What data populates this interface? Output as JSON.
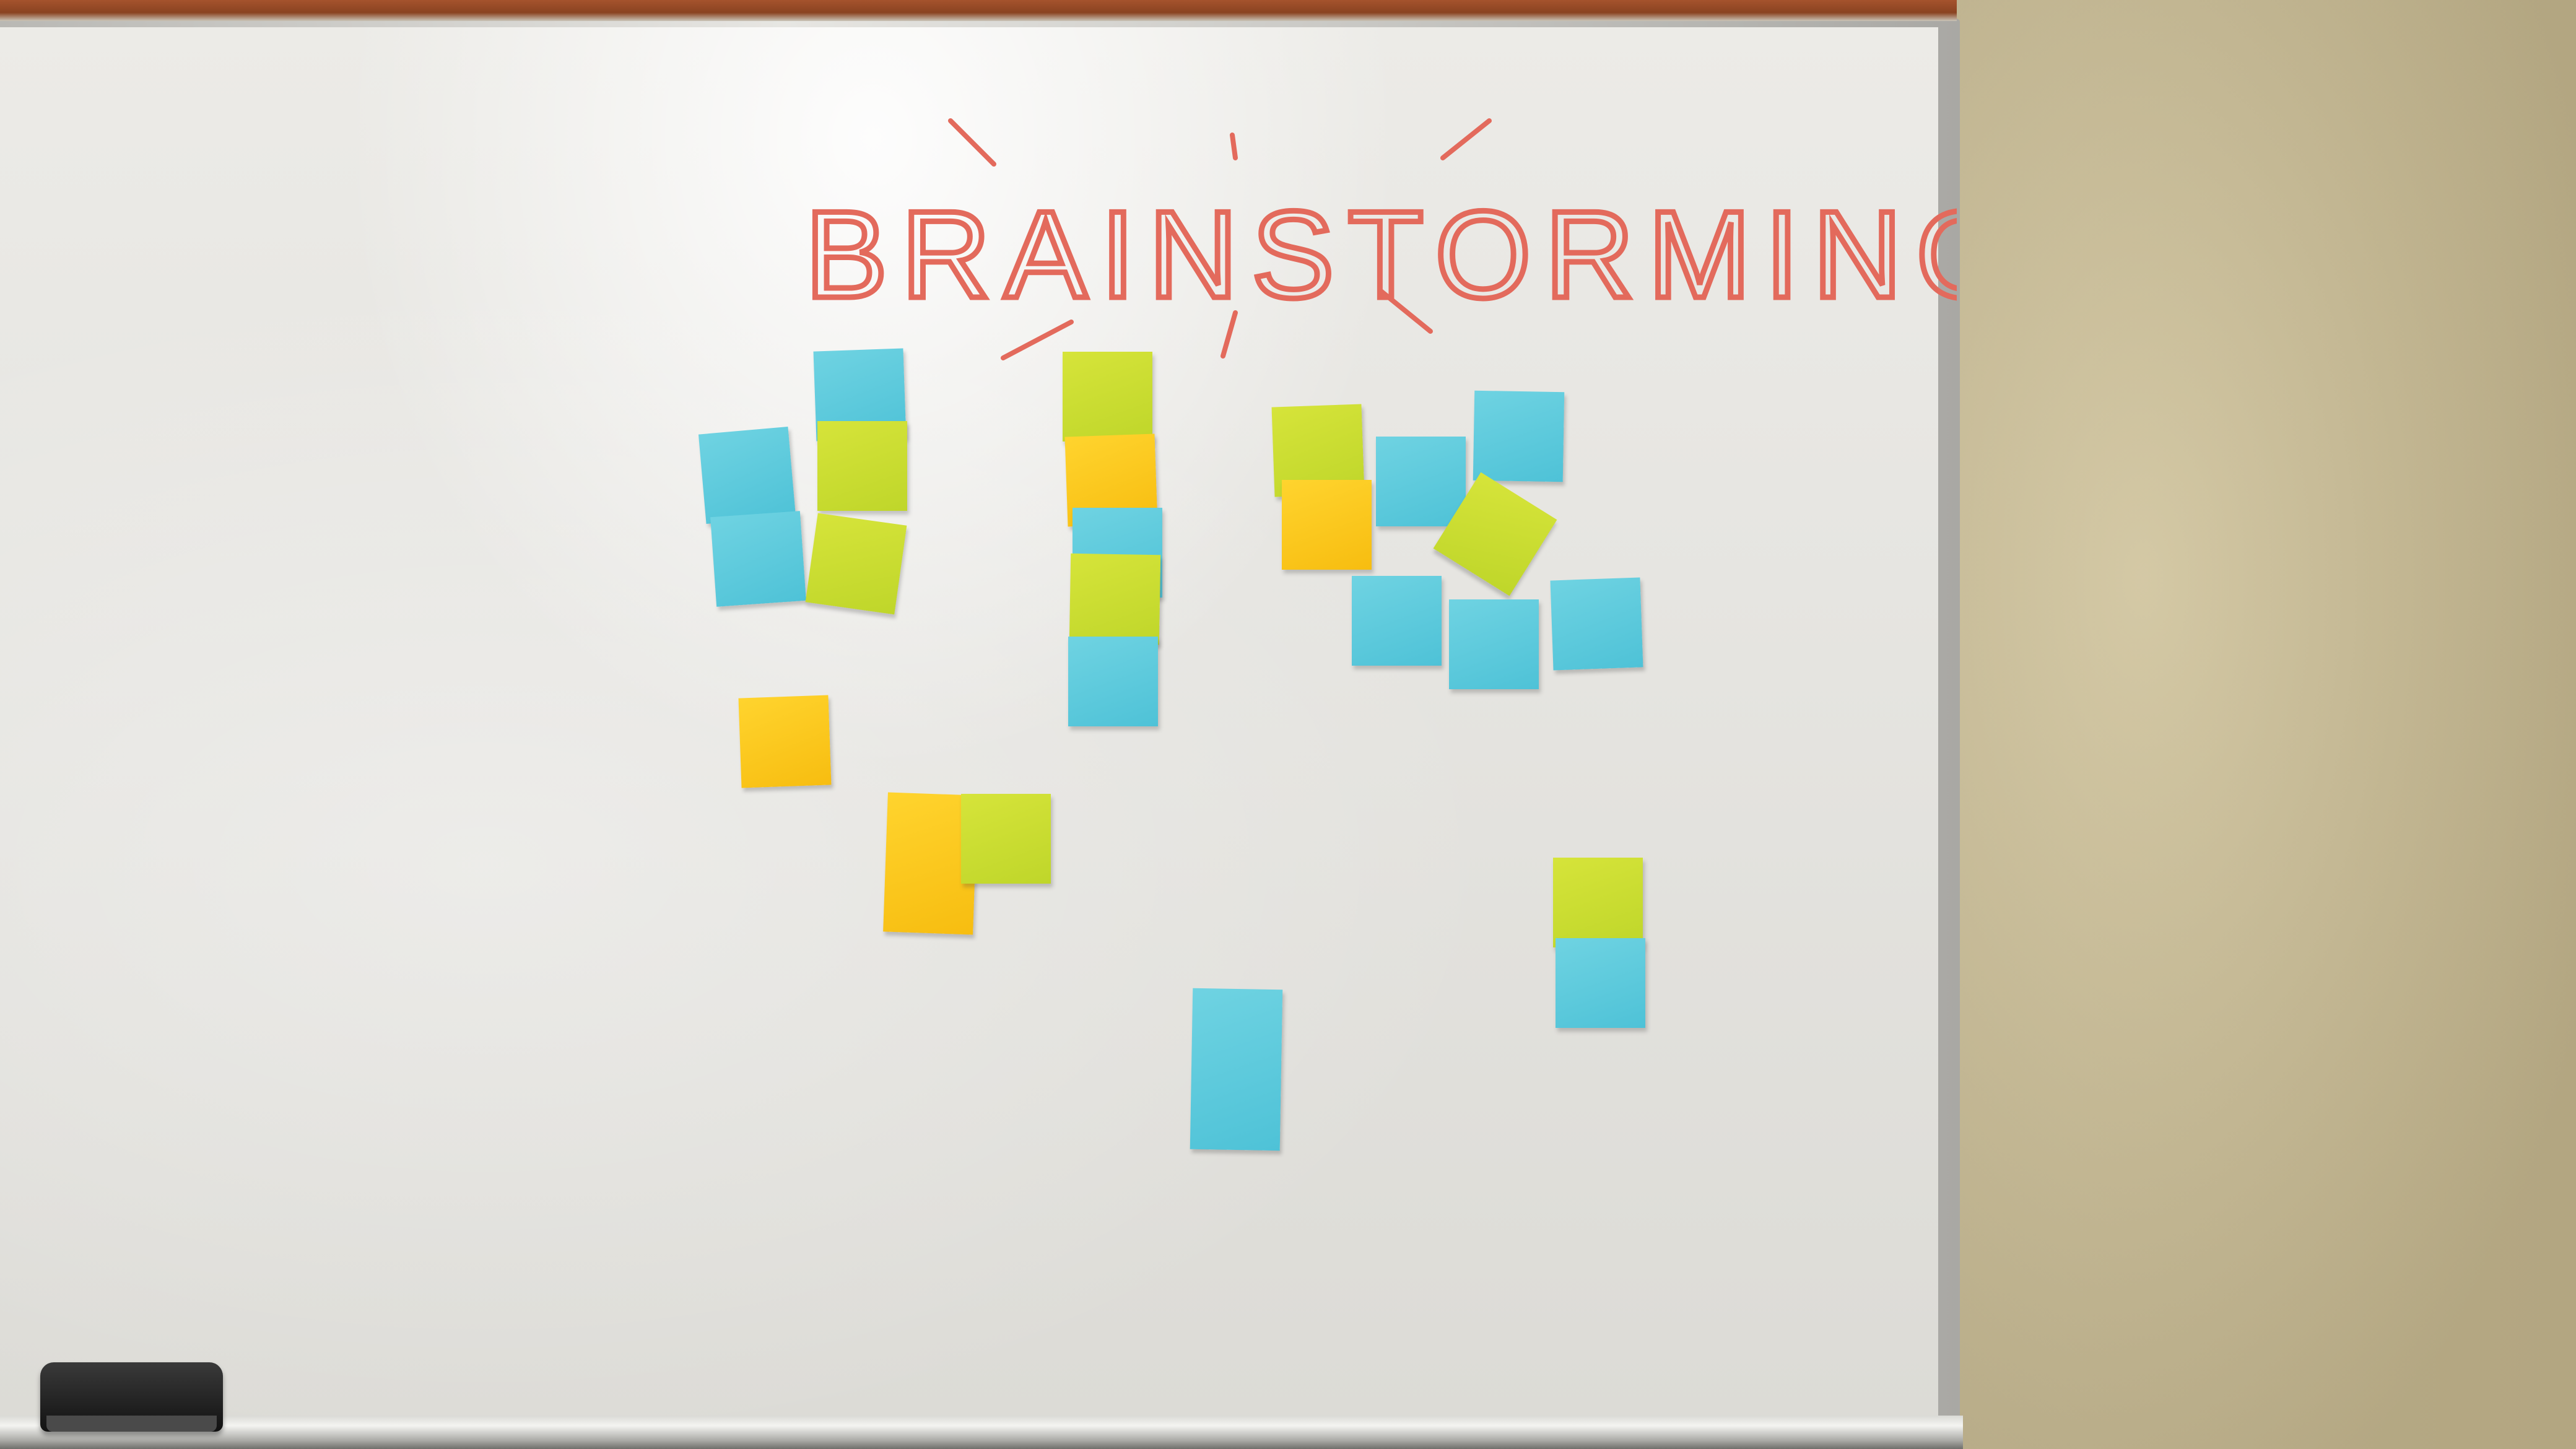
{
  "scene": {
    "title": "BRAINSTORMING",
    "colors": {
      "marker": "#e36a5c",
      "note_blue": "#5ccbdd",
      "note_green": "#c8dd30",
      "note_orange": "#fbc81a",
      "board": "#e8e7e3",
      "wall": "#cfc39f"
    },
    "sticky_notes": [
      {
        "id": "n01",
        "color": "blue"
      },
      {
        "id": "n02",
        "color": "blue"
      },
      {
        "id": "n03",
        "color": "green"
      },
      {
        "id": "n04",
        "color": "blue"
      },
      {
        "id": "n05",
        "color": "green"
      },
      {
        "id": "n06",
        "color": "orange"
      },
      {
        "id": "n07",
        "color": "orange"
      },
      {
        "id": "n08",
        "color": "green"
      },
      {
        "id": "n09",
        "color": "green"
      },
      {
        "id": "n10",
        "color": "orange"
      },
      {
        "id": "n11",
        "color": "blue"
      },
      {
        "id": "n12",
        "color": "green"
      },
      {
        "id": "n13",
        "color": "blue"
      },
      {
        "id": "n14",
        "color": "green"
      },
      {
        "id": "n15",
        "color": "orange"
      },
      {
        "id": "n16",
        "color": "blue"
      },
      {
        "id": "n17",
        "color": "blue"
      },
      {
        "id": "n18",
        "color": "green"
      },
      {
        "id": "n19",
        "color": "blue"
      },
      {
        "id": "n20",
        "color": "blue"
      },
      {
        "id": "n21",
        "color": "blue"
      },
      {
        "id": "n22",
        "color": "blue"
      },
      {
        "id": "n23",
        "color": "green"
      },
      {
        "id": "n24",
        "color": "blue"
      }
    ]
  }
}
